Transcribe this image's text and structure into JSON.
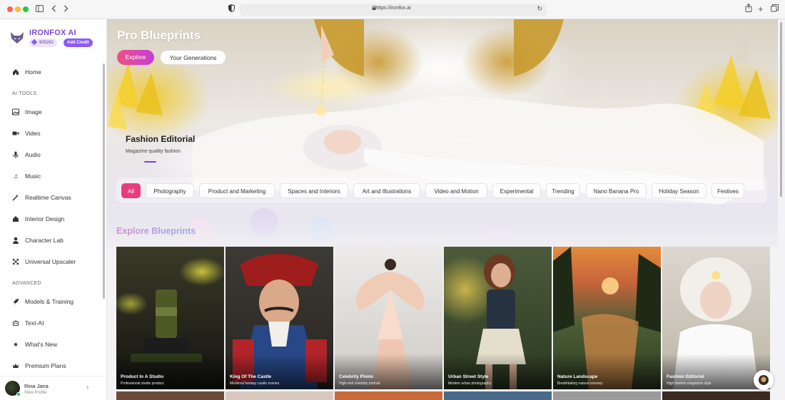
{
  "browser": {
    "url": "https://ironfox.ai"
  },
  "sidebar": {
    "brand": "IRONFOX AI",
    "credits": "905262",
    "add_credit": "Add Credit",
    "home": "Home",
    "section_ai_tools": "AI TOOLS",
    "ai_tools": [
      "Image",
      "Video",
      "Audio",
      "Music",
      "Realtime Canvas",
      "Interior Design",
      "Character Lab",
      "Universal Upscaler"
    ],
    "section_advanced": "ADVANCED",
    "advanced": [
      "Models & Training",
      "Text-AI",
      "What's New",
      "Premium Plans"
    ],
    "profile": {
      "name": "Rina Jana",
      "sub": "View Profile"
    }
  },
  "hero": {
    "title": "Pro Blueprints",
    "tab_explore": "Explore",
    "tab_generations": "Your Generations",
    "featured_title": "Fashion Editorial",
    "featured_subtitle": "Magazine quality fashion"
  },
  "categories": [
    "All",
    "Photography",
    "Product and Marketing",
    "Spaces and Interiors",
    "Art and Illustrations",
    "Video and Motion",
    "Experimental",
    "Trending",
    "Nano Banana Pro",
    "Holiday Season",
    "Festives"
  ],
  "active_category": "All",
  "explore": {
    "title": "Explore Blueprints",
    "cards": [
      {
        "title": "Product In A Studio",
        "subtitle": "Professional studio product"
      },
      {
        "title": "King Of The Castle",
        "subtitle": "Medieval fantasy castle scenes"
      },
      {
        "title": "Celebrity Photo",
        "subtitle": "High-end celebrity portrait"
      },
      {
        "title": "Urban Street Style",
        "subtitle": "Modern urban photography"
      },
      {
        "title": "Nature Landscape",
        "subtitle": "Breathtaking natural scenery"
      },
      {
        "title": "Fashion Editorial",
        "subtitle": "High fashion magazine style"
      }
    ]
  },
  "colors": {
    "brand": "#7d4bd9",
    "accent_pink": "#e53e7d",
    "add_credit_bg": "#8b5cf6"
  }
}
